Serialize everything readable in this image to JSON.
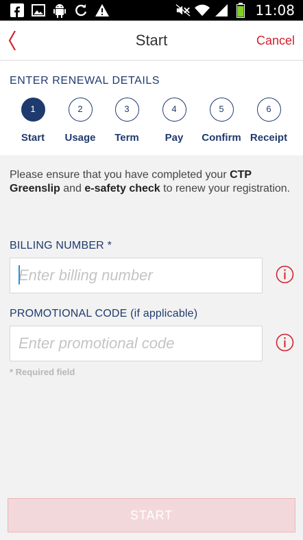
{
  "status_bar": {
    "time": "11:08",
    "left_icons": [
      "facebook-icon",
      "image-icon",
      "android-debug-icon",
      "sync-icon",
      "warning-icon"
    ],
    "right_icons": [
      "mute-icon",
      "wifi-icon",
      "signal-icon",
      "battery-icon"
    ]
  },
  "header": {
    "title": "Start",
    "cancel_label": "Cancel"
  },
  "steps": {
    "heading": "ENTER RENEWAL DETAILS",
    "active_index": 0,
    "items": [
      {
        "number": "1",
        "label": "Start"
      },
      {
        "number": "2",
        "label": "Usage"
      },
      {
        "number": "3",
        "label": "Term"
      },
      {
        "number": "4",
        "label": "Pay"
      },
      {
        "number": "5",
        "label": "Confirm"
      },
      {
        "number": "6",
        "label": "Receipt"
      }
    ]
  },
  "info": {
    "part1": "Please ensure that you have completed your ",
    "bold1": "CTP Greenslip",
    "part2": " and ",
    "bold2": "e-safety check",
    "part3": " to renew your registration."
  },
  "billing": {
    "label": "BILLING NUMBER *",
    "placeholder": "Enter billing number",
    "value": ""
  },
  "promo": {
    "label": "PROMOTIONAL CODE (if applicable)",
    "placeholder": "Enter promotional code",
    "value": ""
  },
  "required_note": "* Required field",
  "start_label": "START",
  "colors": {
    "navy": "#1f3a6e",
    "red": "#d4202e",
    "disabled_button": "#f3d8db"
  }
}
